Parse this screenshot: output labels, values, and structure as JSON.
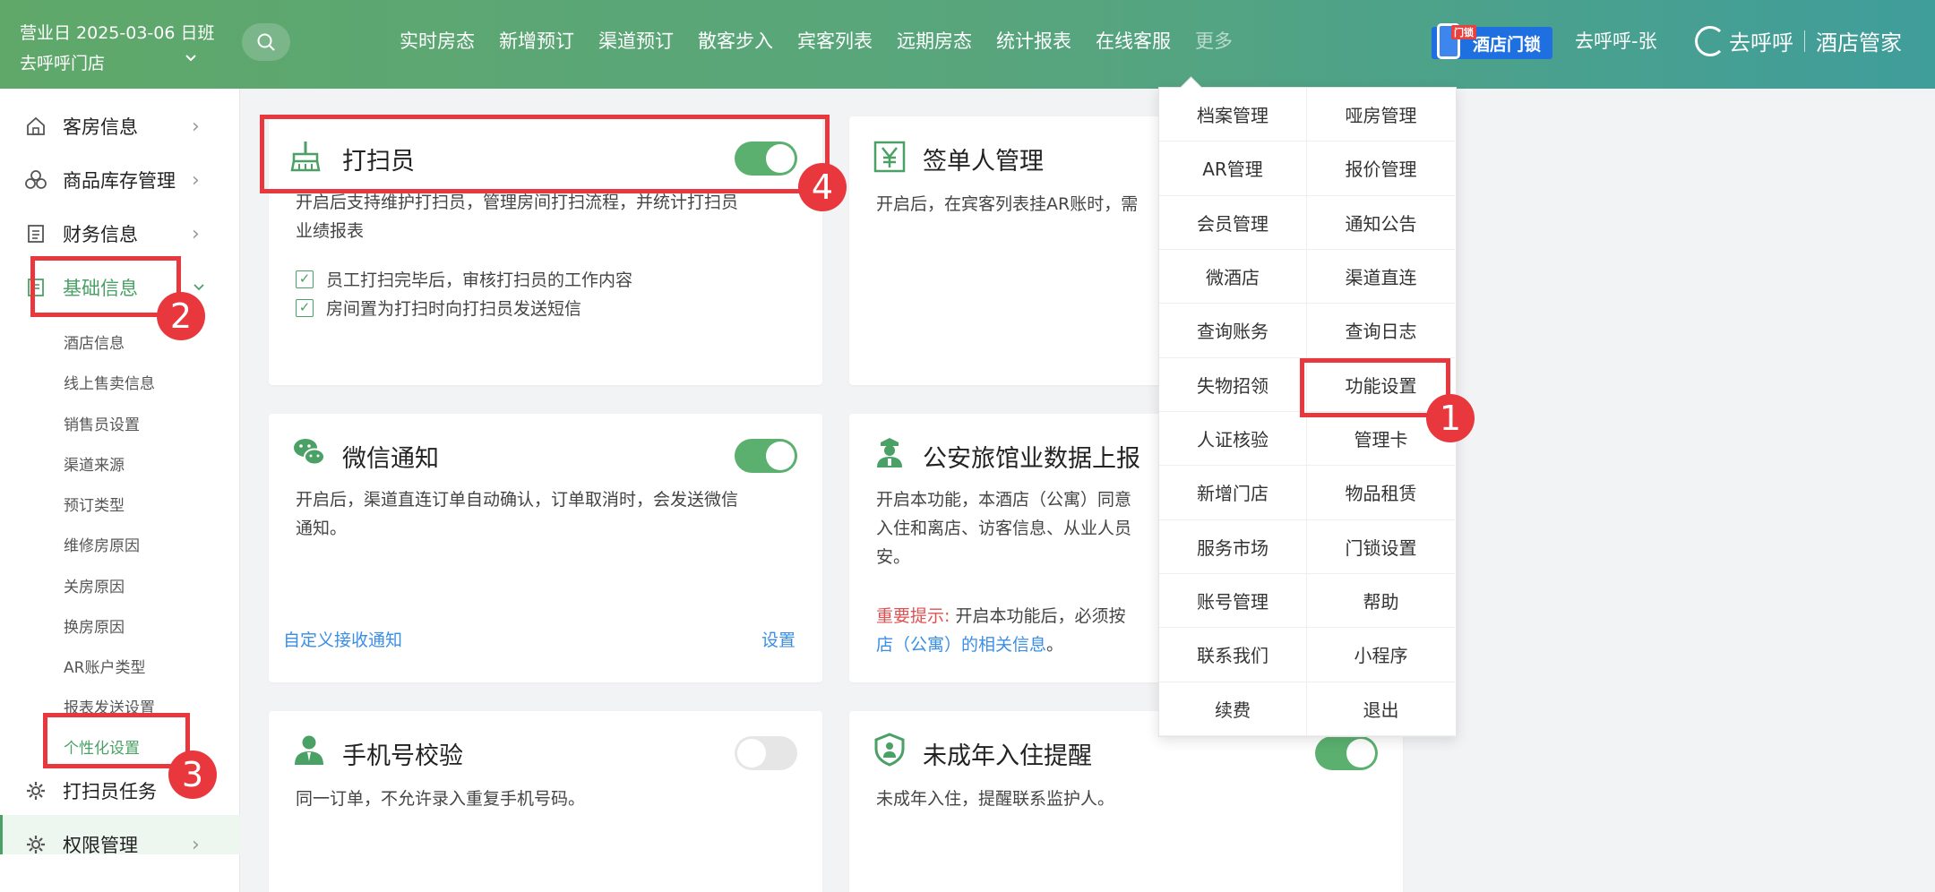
{
  "header": {
    "business_date": "营业日 2025-03-06 日班",
    "store_name": "去呼呼门店",
    "nav": [
      "实时房态",
      "新增预订",
      "渠道预订",
      "散客步入",
      "宾客列表",
      "远期房态",
      "统计报表",
      "在线客服"
    ],
    "more": "更多",
    "lock_badge": "酒店门锁",
    "lock_tag": "门锁",
    "user": "去呼呼-张",
    "brand_logo": "去呼呼",
    "brand_product": "酒店管家"
  },
  "sidebar": {
    "items": [
      {
        "label": "客房信息",
        "icon": "home-icon"
      },
      {
        "label": "商品库存管理",
        "icon": "boxes-icon"
      },
      {
        "label": "财务信息",
        "icon": "document-icon"
      },
      {
        "label": "基础信息",
        "icon": "list-icon"
      },
      {
        "label": "打扫员任务",
        "icon": "gear-icon"
      },
      {
        "label": "权限管理",
        "icon": "gear-icon"
      }
    ],
    "sub_items": [
      "酒店信息",
      "线上售卖信息",
      "销售员设置",
      "渠道来源",
      "预订类型",
      "维修房原因",
      "关房原因",
      "换房原因",
      "AR账户类型",
      "报表发送设置",
      "个性化设置"
    ]
  },
  "cards": {
    "cleaner": {
      "title": "打扫员",
      "desc1": "开启后支持维护打扫员，管理房间打扫流程，并统计打扫员",
      "desc2": "业绩报表",
      "check1": "员工打扫完毕后，审核打扫员的工作内容",
      "check2": "房间置为打扫时向打扫员发送短信",
      "enabled": true
    },
    "signer": {
      "title": "签单人管理",
      "desc": "开启后，在宾客列表挂AR账时，需"
    },
    "wechat": {
      "title": "微信通知",
      "desc1": "开启后，渠道直连订单自动确认，订单取消时，会发送微信",
      "desc2": "通知。",
      "link_left": "自定义接收通知",
      "link_right": "设置",
      "enabled": true
    },
    "police": {
      "title": "公安旅馆业数据上报",
      "desc1": "开启本功能，本酒店（公寓）同意",
      "desc2": "入住和离店、访客信息、从业人员",
      "desc3": "安。",
      "warn_label": "重要提示:",
      "warn_text": "开启本功能后，必须按",
      "link_text": "店（公寓）的相关信息",
      "tail": "。"
    },
    "phone": {
      "title": "手机号校验",
      "desc": "同一订单，不允许录入重复手机号码。",
      "enabled": false
    },
    "minor": {
      "title": "未成年入住提醒",
      "desc": "未成年入住，提醒联系监护人。",
      "enabled": true
    }
  },
  "dropdown": [
    "档案管理",
    "哑房管理",
    "AR管理",
    "报价管理",
    "会员管理",
    "通知公告",
    "微酒店",
    "渠道直连",
    "查询账务",
    "查询日志",
    "失物招领",
    "功能设置",
    "人证核验",
    "管理卡",
    "新增门店",
    "物品租赁",
    "服务市场",
    "门锁设置",
    "账号管理",
    "帮助",
    "联系我们",
    "小程序",
    "续费",
    "退出"
  ],
  "annotations": [
    "1",
    "2",
    "3",
    "4"
  ],
  "colors": {
    "accent": "#4aa065",
    "annotation": "#e8383d",
    "link": "#3a8ee6"
  }
}
